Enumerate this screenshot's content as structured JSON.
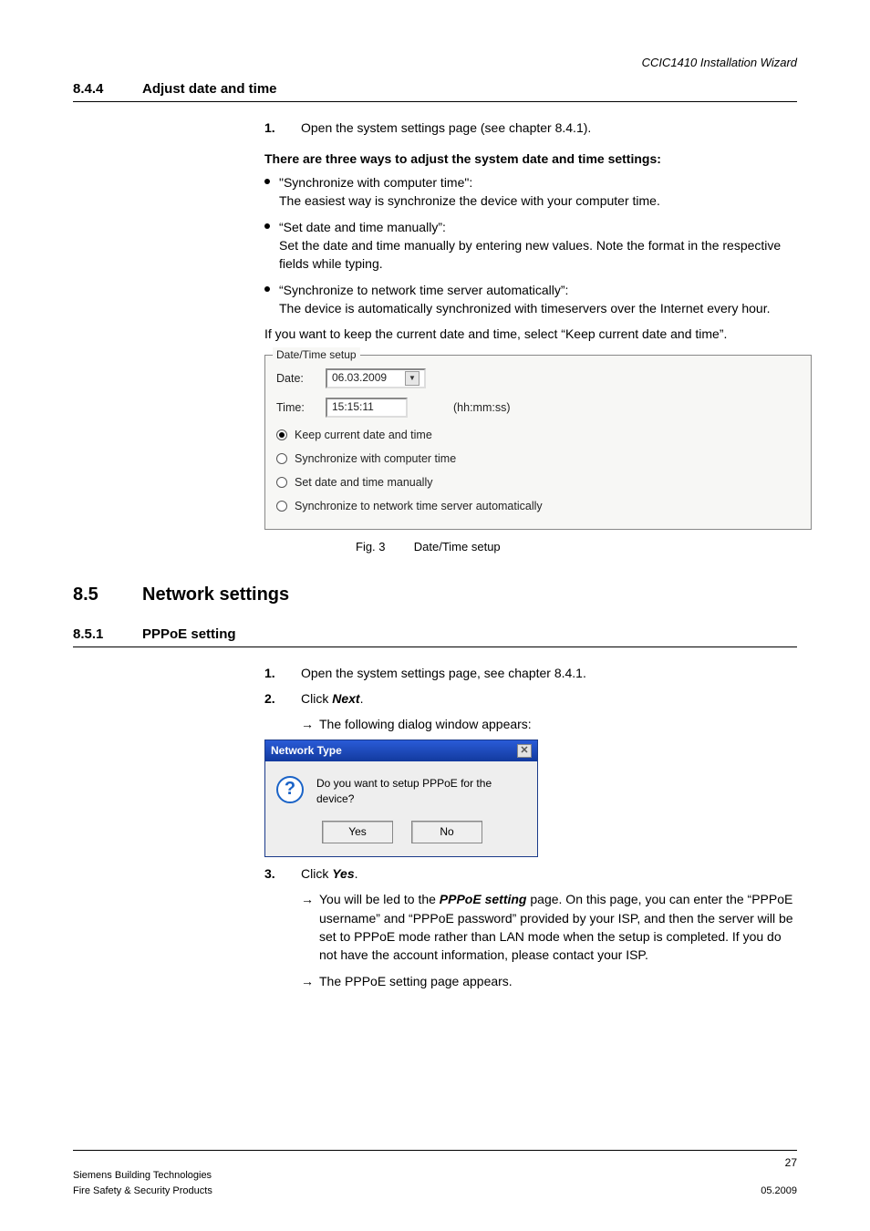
{
  "header": {
    "doc_title": "CCIC1410 Installation Wizard"
  },
  "sec844": {
    "num": "8.4.4",
    "title": "Adjust date and time",
    "step1_num": "1.",
    "step1_text": "Open the system settings page (see chapter 8.4.1).",
    "intro_bold": "There are three ways to adjust the system date and time settings:",
    "bul1_a": "\"Synchronize with computer time\":",
    "bul1_b": "The easiest way is synchronize the device with your computer time.",
    "bul2_a": "“Set date and time manually”:",
    "bul2_b": "Set the date and time manually by entering new values. Note the format in the respective fields while typing.",
    "bul3_a": "“Synchronize to network time server automatically”:",
    "bul3_b": "The device is automatically synchronized with timeservers over the Internet every hour.",
    "keep_line": "If you want to keep the current date and time, select  “Keep current date and time”."
  },
  "datetime_box": {
    "legend": "Date/Time setup",
    "date_label": "Date:",
    "date_value": "06.03.2009",
    "time_label": "Time:",
    "time_value": "15:15:11",
    "time_hint": "(hh:mm:ss)",
    "r1": "Keep current date and time",
    "r2": "Synchronize with computer time",
    "r3": "Set date and time manually",
    "r4": "Synchronize to network time server automatically",
    "selected": "r1"
  },
  "fig3": {
    "label": "Fig. 3",
    "caption": "Date/Time setup"
  },
  "sec85": {
    "num": "8.5",
    "title": "Network settings"
  },
  "sec851": {
    "num": "8.5.1",
    "title": "PPPoE setting",
    "s1_num": "1.",
    "s1_text": "Open the system settings page, see chapter 8.4.1.",
    "s2_num": "2.",
    "s2_text_a": "Click ",
    "s2_text_b": "Next",
    "s2_text_c": ".",
    "s2_arrow": "The following dialog window appears:",
    "s3_num": "3.",
    "s3_text_a": "Click ",
    "s3_text_b": "Yes",
    "s3_text_c": ".",
    "s3_arrow1_a": "You will be led to the ",
    "s3_arrow1_b": "PPPoE setting",
    "s3_arrow1_c": " page. On this page, you can enter the “PPPoE username” and “PPPoE password” provided by your ISP, and then the server will be set to PPPoE mode rather than LAN mode when the setup is completed. If you do not have the account information, please contact your ISP.",
    "s3_arrow2": "The PPPoE setting page appears."
  },
  "dialog": {
    "title": "Network Type",
    "msg": "Do you want to setup PPPoE for the device?",
    "yes": "Yes",
    "no": "No"
  },
  "footer": {
    "page": "27",
    "l1": "Siemens Building Technologies",
    "l2": "Fire Safety & Security Products",
    "date": "05.2009"
  }
}
